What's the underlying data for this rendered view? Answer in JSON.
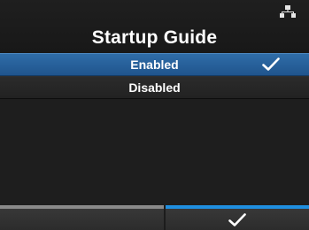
{
  "header": {
    "title": "Startup Guide",
    "status_icon": "network-icon"
  },
  "list": {
    "items": [
      {
        "label": "Enabled",
        "selected": true,
        "checked": true
      },
      {
        "label": "Disabled",
        "selected": false,
        "checked": false
      }
    ]
  },
  "footer": {
    "left_key": {
      "icon": "none",
      "bar_color": "#8a8a8a"
    },
    "right_key": {
      "icon": "check-icon",
      "bar_color": "#1f8fe0"
    }
  },
  "colors": {
    "selection": "#2b65a0",
    "background": "#1c1c1c",
    "accent": "#1f8fe0"
  }
}
